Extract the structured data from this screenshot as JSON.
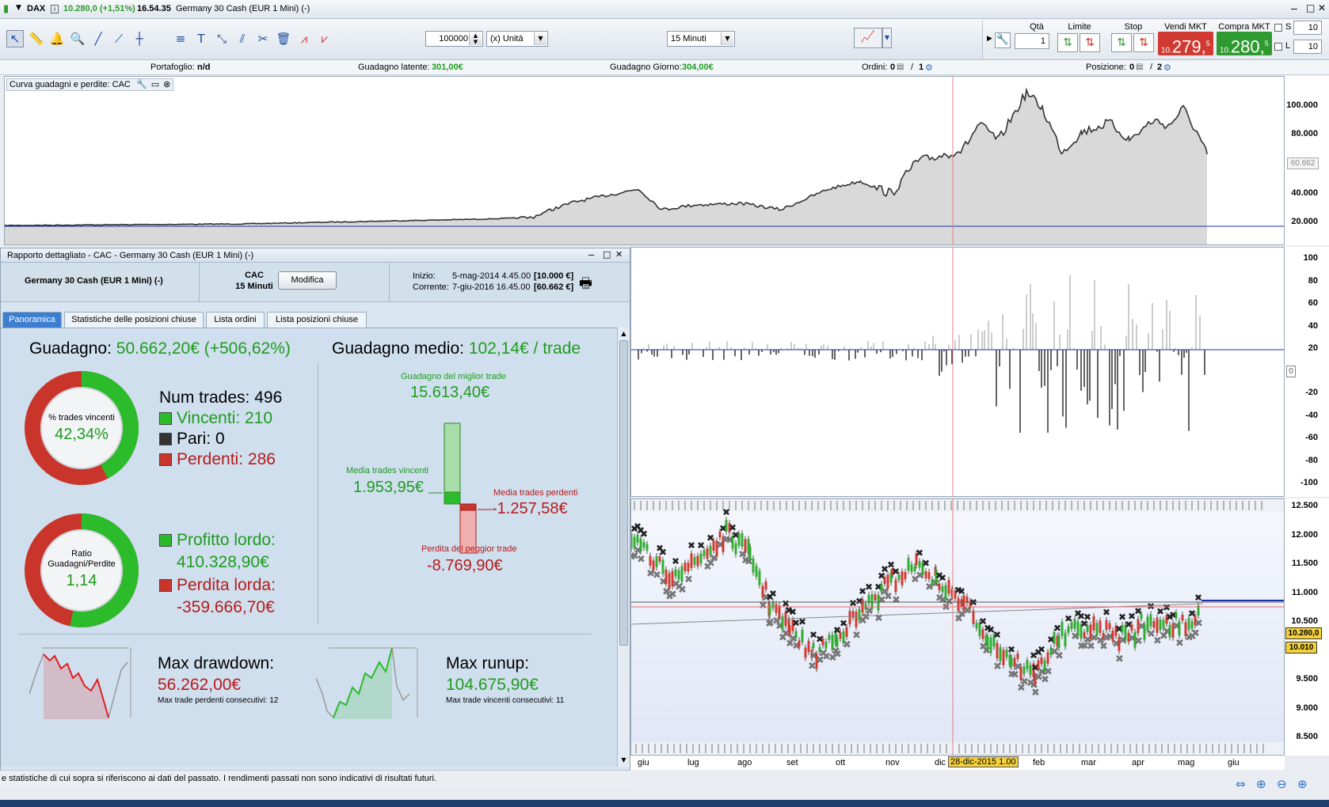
{
  "titlebar": {
    "symbol": "DAX",
    "price_change": "10.280,0 (+1,51%)",
    "time": "16.54.35",
    "instrument": "Germany 30 Cash (EUR 1 Mini) (-)"
  },
  "toolbar": {
    "quantity_value": "100000",
    "unit_select": "(x) Unità",
    "timeframe_select": "15 Minuti",
    "qty_label": "Qtà",
    "qty_value": "1",
    "limit_label": "Limite",
    "stop_label": "Stop",
    "sell_label": "Vendi MKT",
    "buy_label": "Compra MKT",
    "sell_prefix": "10.",
    "sell_main": "279,",
    "sell_sup": "5",
    "buy_prefix": "10.",
    "buy_main": "280,",
    "buy_sup": "5",
    "s_label": "S",
    "s_value": "10",
    "l_label": "L",
    "l_value": "10",
    "sell_color": "#d03a32",
    "buy_color": "#2f9a2f"
  },
  "statusrow": {
    "portfolio_label": "Portafoglio:",
    "portfolio_value": "n/d",
    "latent_label": "Guadagno latente:",
    "latent_value": "301,00€",
    "day_label": "Guadagno Giorno:",
    "day_value": "304,00€",
    "orders_label": "Ordini:",
    "orders_a": "0",
    "orders_b": "1",
    "position_label": "Posizione:",
    "position_a": "0",
    "position_b": "2",
    "value_color": "#1f9b1f"
  },
  "equity_panel": {
    "title": "Curva guadagni e perdite: CAC",
    "yticks": [
      "100.000",
      "80.000",
      "60.662",
      "40.000",
      "20.000"
    ],
    "current_label": "60.662"
  },
  "histogram_panel": {
    "yticks": [
      "100",
      "80",
      "60",
      "40",
      "20",
      "0",
      "-20",
      "-40",
      "-60",
      "-80",
      "-100"
    ]
  },
  "price_panel": {
    "yticks": [
      "12.500",
      "12.000",
      "11.500",
      "11.000",
      "10.500",
      "10.000",
      "9.500",
      "9.000",
      "8.500"
    ],
    "current_price": "10.280,0",
    "level_price": "10.010"
  },
  "xaxis": {
    "months": [
      "giu",
      "lug",
      "ago",
      "set",
      "ott",
      "nov",
      "dic",
      "feb",
      "mar",
      "apr",
      "mag",
      "giu"
    ],
    "cursor_date": "28-dic-2015 1.00"
  },
  "report": {
    "window_title": "Rapporto dettagliato - CAC - Germany 30 Cash (EUR 1 Mini) (-)",
    "instrument": "Germany 30 Cash (EUR 1 Mini) (-)",
    "system_name": "CAC",
    "system_tf": "15 Minuti",
    "modify_button": "Modifica",
    "start_label": "Inizio:",
    "start_value": "5-mag-2014 4.45.00",
    "start_capital": "[10.000 €]",
    "current_label": "Corrente:",
    "current_value": "7-giu-2016 16.45.00",
    "current_capital": "[60.662 €]",
    "tabs": [
      "Panoramica",
      "Statistiche delle posizioni chiuse",
      "Lista ordini",
      "Lista posizioni chiuse"
    ],
    "gain_label": "Guadagno:",
    "gain_value": "50.662,20€ (+506,62%)",
    "avg_label": "Guadagno medio:",
    "avg_value": "102,14€ / trade",
    "donut1_caption": "% trades vincenti",
    "donut1_value": "42,34%",
    "donut1_fraction": 0.4234,
    "num_trades": "Num trades: 496",
    "winners": "Vincenti: 210",
    "even": "Pari: 0",
    "losers": "Perdenti: 286",
    "donut2_caption": "Ratio Guadagni/Perdite",
    "donut2_value": "1,14",
    "gross_profit_label": "Profitto lordo:",
    "gross_profit_value": "410.328,90€",
    "gross_loss_label": "Perdita lorda:",
    "gross_loss_value": "-359.666,70€",
    "best_trade_label": "Guadagno del miglior trade",
    "best_trade_value": "15.613,40€",
    "avg_win_label": "Media trades vincenti",
    "avg_win_value": "1.953,95€",
    "avg_loss_label": "Media trades perdenti",
    "avg_loss_value": "-1.257,58€",
    "worst_trade_label": "Perdita del peggior trade",
    "worst_trade_value": "-8.769,90€",
    "max_dd_label": "Max drawdown:",
    "max_dd_value": "56.262,00€",
    "max_dd_sub": "Max trade perdenti consecutivi:",
    "max_dd_sub_value": "12",
    "max_ru_label": "Max runup:",
    "max_ru_value": "104.675,90€",
    "max_ru_sub": "Max trade vincenti consecutivi:",
    "max_ru_sub_value": "11",
    "footer": "e statistiche di cui sopra si riferiscono ai dati del passato. I rendimenti passati non sono indicativi di risultati futuri.",
    "green": "#2bbb2b",
    "red": "#c9352b"
  }
}
